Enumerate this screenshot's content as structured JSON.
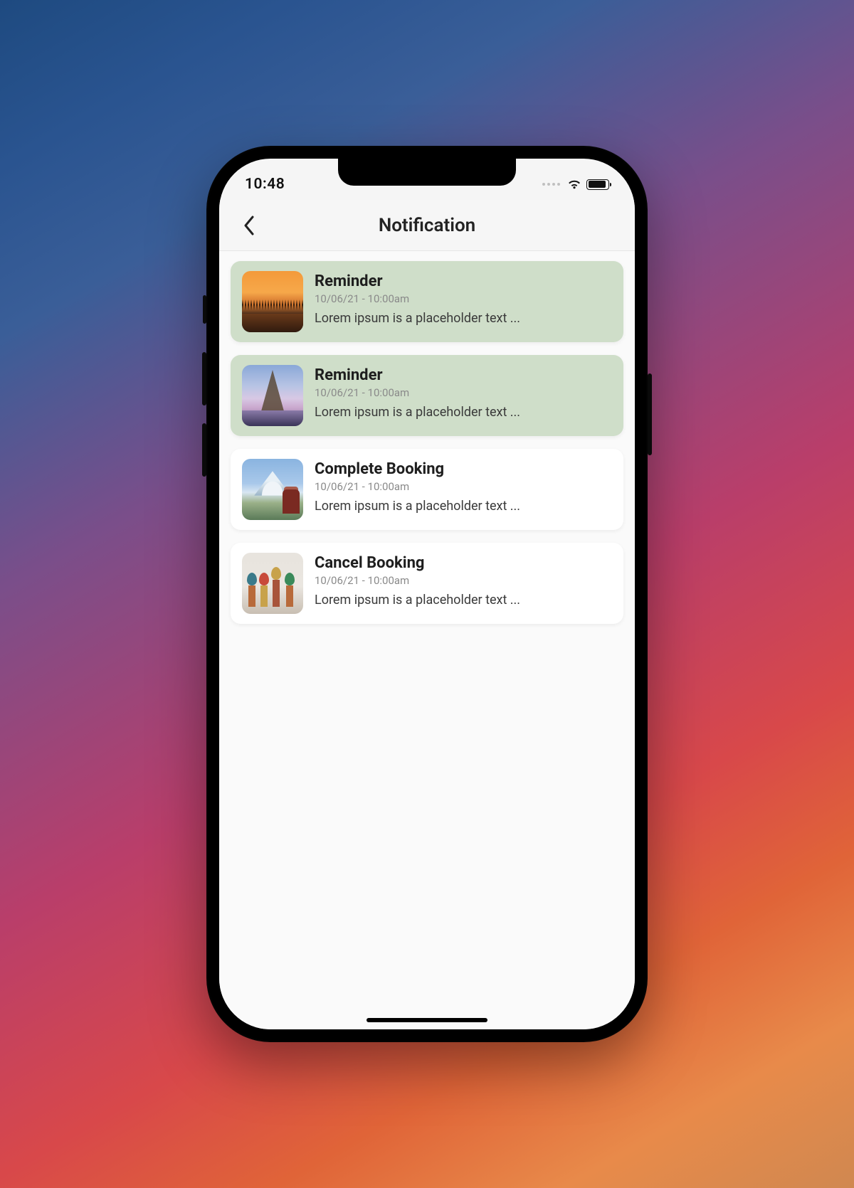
{
  "status": {
    "time": "10:48"
  },
  "header": {
    "title": "Notification"
  },
  "notifications": [
    {
      "title": "Reminder",
      "time": "10/06/21 - 10:00am",
      "text": "Lorem ipsum is a placeholder text ...",
      "unread": true,
      "thumb": "sunset"
    },
    {
      "title": "Reminder",
      "time": "10/06/21 - 10:00am",
      "text": "Lorem ipsum is a placeholder text ...",
      "unread": true,
      "thumb": "eiffel"
    },
    {
      "title": "Complete Booking",
      "time": "10/06/21 - 10:00am",
      "text": "Lorem ipsum is a placeholder text ...",
      "unread": false,
      "thumb": "fuji"
    },
    {
      "title": "Cancel Booking",
      "time": "10/06/21 - 10:00am",
      "text": "Lorem ipsum is a placeholder text ...",
      "unread": false,
      "thumb": "moscow"
    }
  ]
}
